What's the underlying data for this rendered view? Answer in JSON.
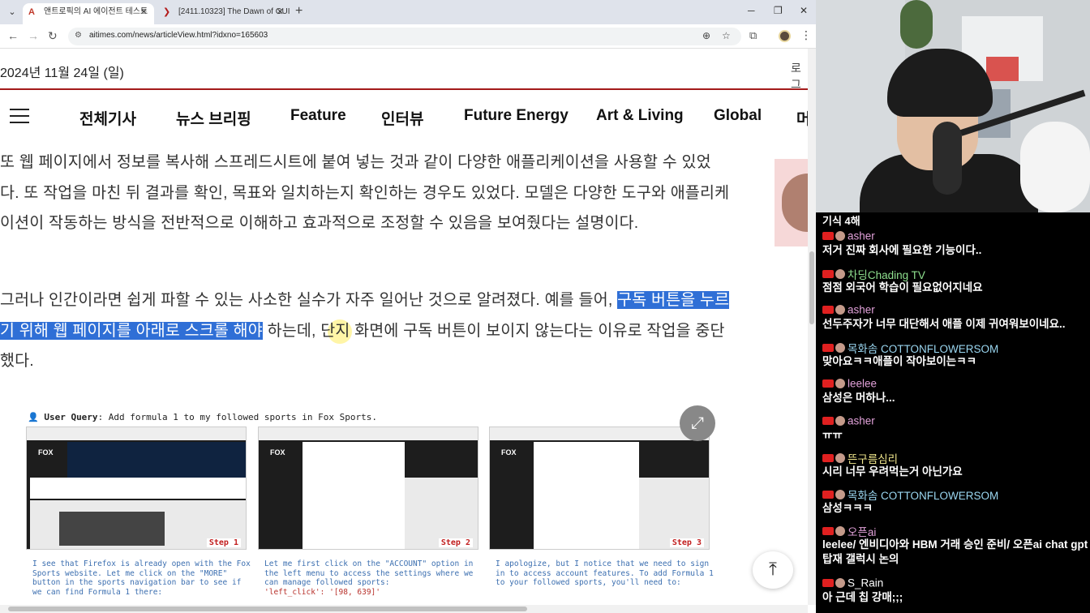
{
  "browser": {
    "tabs": [
      {
        "title": "앤트로픽의 AI 에이전트 테스트",
        "favicon": "A",
        "favicon_color": "#c0392b",
        "active": true
      },
      {
        "title": "[2411.10323] The Dawn of GUI",
        "favicon": "❯",
        "favicon_color": "#b31b1b",
        "active": false
      }
    ],
    "new_tab": "+",
    "window_controls": {
      "minimize": "─",
      "maximize": "❐",
      "close": "✕"
    },
    "url": "aitimes.com/news/articleView.html?idxno=165603"
  },
  "page": {
    "date": "2024년 11월 24일 (일)",
    "login": "로그",
    "menu": [
      "전체기사",
      "뉴스 브리핑",
      "Feature",
      "인터뷰",
      "Future Energy",
      "Art & Living",
      "Global",
      "머"
    ],
    "para1": "또 웹 페이지에서 정보를 복사해 스프레드시트에 붙여 넣는 것과 같이 다양한 애플리케이션을 사용할 수 있었다. 또 작업을 마친 뒤 결과를 확인, 목표와 일치하는지 확인하는 경우도 있었다. 모델은 다양한 도구와 애플리케이션이 작동하는 방식을 전반적으로 이해하고 효과적으로 조정할 수 있음을 보여줬다는 설명이다.",
    "para2_before": "그러나 인간이라면 쉽게 파할 수 있는 사소한 실수가 자주 일어난 것으로 알려졌다. 예를 들어, ",
    "para2_highlight": "구독 버튼을 누르기 위해 웹 페이지를 아래로 스크롤 해야",
    "para2_after": " 하는데, 단지 화면에 구독 버튼이 보이지 않는다는 이유로 작업을 중단했다.",
    "figure": {
      "user_query_label": "User Query",
      "user_query_text": ": Add formula 1 to my followed sports in Fox Sports.",
      "steps": [
        {
          "label": "Step 1",
          "caption": "I see that Firefox is already open with the Fox Sports website. Let me click on the \"MORE\" button in the sports navigation bar to see if we can find Formula 1 there:",
          "code": ""
        },
        {
          "label": "Step 2",
          "caption": "Let me first click on the \"ACCOUNT\" option in the left menu to access the settings where we can manage followed sports:",
          "code": "'left_click': '[98, 639]'"
        },
        {
          "label": "Step 3",
          "caption": "I apologize, but I notice that we need to sign in to access account features. To add Formula 1 to your followed sports, you'll need to:",
          "code": ""
        }
      ]
    }
  },
  "chat": {
    "partial_top": "기식 4해",
    "messages": [
      {
        "name": "asher",
        "name_color": "#e0a0d8",
        "text": "저거 진짜 회사에 필요한 기능이다.."
      },
      {
        "name": "차딩Chading TV",
        "name_color": "#8fe08f",
        "text": "점점 외국어 학습이 필요없어지네요"
      },
      {
        "name": "asher",
        "name_color": "#e0a0d8",
        "text": "선두주자가 너무 대단해서 애플 이제 귀여워보이네요.."
      },
      {
        "name": "목화솜 COTTONFLOWERSOM",
        "name_color": "#9ad6f0",
        "text": "맞아요ㅋㅋ애플이 작아보이는ㅋㅋ"
      },
      {
        "name": "leelee",
        "name_color": "#e0a0d8",
        "text": "삼성은 머하나..."
      },
      {
        "name": "asher",
        "name_color": "#e0a0d8",
        "text": "ㅠㅠ"
      },
      {
        "name": "뜬구름심리",
        "name_color": "#f0e68c",
        "text": "시리 너무 우려먹는거 아닌가요"
      },
      {
        "name": "목화솜 COTTONFLOWERSOM",
        "name_color": "#9ad6f0",
        "text": "삼성ㅋㅋㅋ"
      },
      {
        "name": "오픈ai",
        "name_color": "#e0a0d8",
        "text": "leelee/ 엔비디아와 HBM 거래 승인 준비/ 오픈ai chat gpt 탑재 갤럭시 논의"
      },
      {
        "name": "S_Rain",
        "name_color": "#ffffff",
        "text": "아 근데 칩 강매;;;"
      }
    ]
  }
}
